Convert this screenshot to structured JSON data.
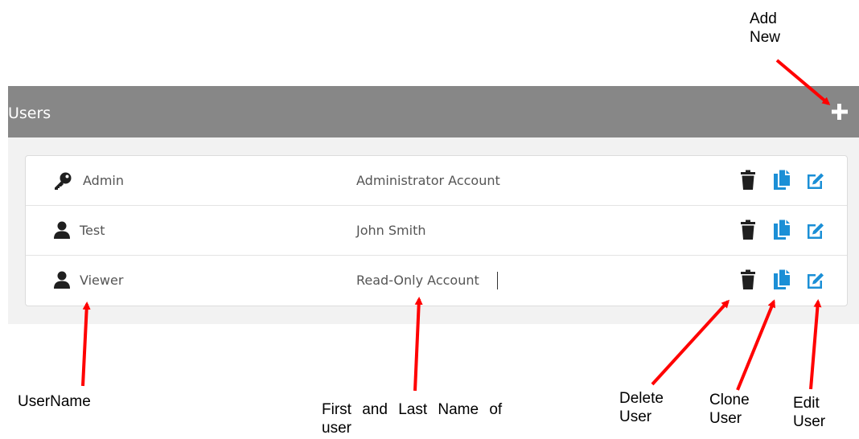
{
  "panel": {
    "title": "Users",
    "add_icon": "plus-icon",
    "header_color": "#878787"
  },
  "users": [
    {
      "username": "Admin",
      "full_name": "Administrator Account",
      "icon": "key-icon"
    },
    {
      "username": "Test",
      "full_name": "John Smith",
      "icon": "user-icon"
    },
    {
      "username": "Viewer",
      "full_name": "Read-Only Account",
      "icon": "user-icon"
    }
  ],
  "actions": {
    "delete_icon": "trash-icon",
    "clone_icon": "copy-icon",
    "edit_icon": "edit-icon",
    "accent_color": "#1b8fd6"
  },
  "annotations": {
    "add_new": "Add New",
    "username": "UserName",
    "full_name": "First and Last Name of user",
    "delete_user": "Delete User",
    "clone_user": "Clone User",
    "edit_user": "Edit User",
    "arrow_color": "#ff0000"
  }
}
